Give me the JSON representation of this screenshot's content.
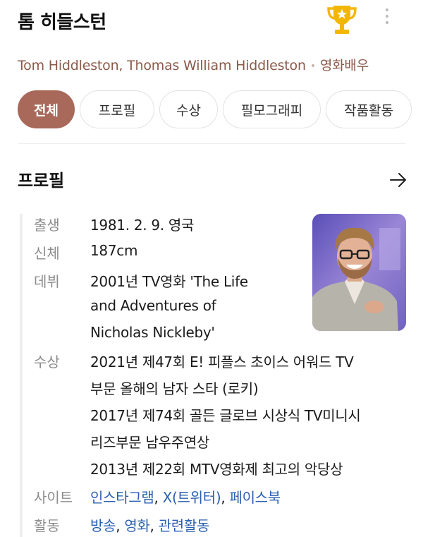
{
  "header": {
    "title": "톰 히들스턴"
  },
  "subtitle": {
    "names": "Tom Hiddleston, Thomas William Hiddleston",
    "separator": "•",
    "occupation": "영화배우"
  },
  "tabs": [
    {
      "label": "전체",
      "active": true
    },
    {
      "label": "프로필",
      "active": false
    },
    {
      "label": "수상",
      "active": false
    },
    {
      "label": "필모그래피",
      "active": false
    },
    {
      "label": "작품활동",
      "active": false
    }
  ],
  "profile": {
    "section_title": "프로필",
    "birth": {
      "label": "출생",
      "value": "1981. 2. 9. 영국"
    },
    "body": {
      "label": "신체",
      "value": "187cm"
    },
    "debut": {
      "label": "데뷔",
      "lines": [
        "2001년 TV영화 'The Life",
        "and Adventures of",
        "Nicholas Nickleby'"
      ]
    },
    "awards": {
      "label": "수상",
      "lines": [
        "2021년 제47회 E! 피플스 초이스 어워드 TV",
        "부문 올해의 남자 스타 (로키)",
        "2017년 제74회 골든 글로브 시상식 TV미니시",
        "리즈부문 남우주연상",
        "2013년 제22회 MTV영화제 최고의 악당상"
      ]
    },
    "site": {
      "label": "사이트",
      "links": [
        "인스타그램",
        "X(트위터)",
        "페이스북"
      ],
      "separator": ","
    },
    "activity": {
      "label": "활동",
      "links": [
        "방송",
        "영화",
        "관련활동"
      ],
      "separator": ","
    }
  },
  "colors": {
    "accent": "#a8695a",
    "subtitle": "#8a5a4a",
    "link": "#2a5fb0",
    "trophy": "#f2b705"
  },
  "icons": {
    "trophy": "trophy-icon",
    "more": "more-vertical-icon",
    "arrow": "arrow-right-icon"
  }
}
